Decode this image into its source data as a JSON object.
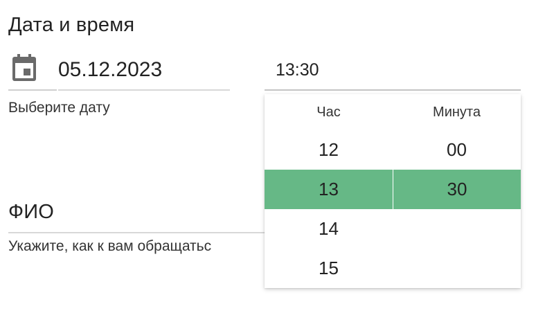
{
  "datetime_section": {
    "title": "Дата и время",
    "date_value": "05.12.2023",
    "date_helper": "Выберите дату",
    "time_value": "13:30"
  },
  "time_picker": {
    "hours_header": "Час",
    "minutes_header": "Минута",
    "hours": [
      "12",
      "13",
      "14",
      "15"
    ],
    "minutes": [
      "00",
      "30"
    ],
    "selected_hour": "13",
    "selected_minute": "30",
    "selected_color": "#66b886"
  },
  "name_section": {
    "title": "ФИО",
    "helper": "Укажите, как к вам обращатьс"
  },
  "icons": {
    "calendar": "calendar-icon"
  }
}
